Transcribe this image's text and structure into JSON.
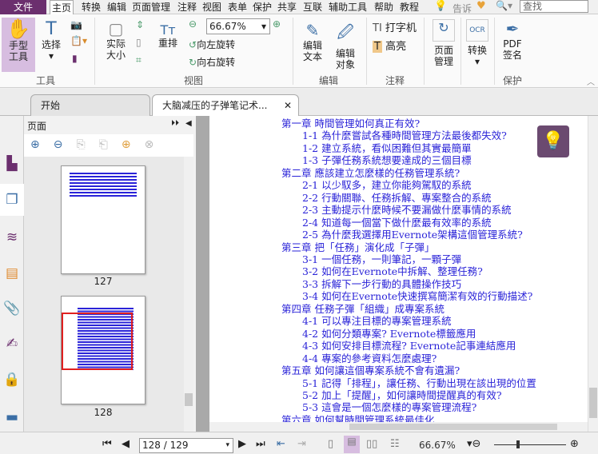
{
  "menu": {
    "file": "文件",
    "items": [
      "主页",
      "转换",
      "编辑",
      "页面管理",
      "注释",
      "视图",
      "表单",
      "保护",
      "共享",
      "互联",
      "辅助工具",
      "帮助",
      "教程"
    ],
    "tell": "告诉",
    "search_placeholder": "查找"
  },
  "ribbon": {
    "hand": "手型\n工具",
    "select": "选择",
    "group_tools": "工具",
    "actual_size": "实际\n大小",
    "reflow": "重排",
    "zoom": "66.67%",
    "rotate_left": "向左旋转",
    "rotate_right": "向右旋转",
    "group_view": "视图",
    "edit_text": "编辑\n文本",
    "edit_object": "编辑\n对象",
    "group_edit": "编辑",
    "typewriter": "打字机",
    "highlight": "高亮",
    "group_comment": "注释",
    "page_manage": "页面\n管理",
    "convert": "转换",
    "pdf_sign": "PDF\n签名",
    "group_protect": "保护"
  },
  "tabs": [
    {
      "label": "开始"
    },
    {
      "label": "大脑减压的子弹笔记术..."
    }
  ],
  "panel": {
    "title": "页面",
    "pages": [
      "127",
      "128"
    ]
  },
  "toc": [
    {
      "t": "第一章 時間管理如何真正有效?",
      "sub": false
    },
    {
      "t": "1-1 為什麼嘗試各種時間管理方法最後都失效?",
      "sub": true
    },
    {
      "t": "1-2 建立系統，看似困難但其實最簡單",
      "sub": true
    },
    {
      "t": "1-3 子彈任務系統想要達成的三個目標",
      "sub": true
    },
    {
      "t": "第二章 應該建立怎麼樣的任務管理系統?",
      "sub": false
    },
    {
      "t": "2-1 以少馭多，建立你能夠駕馭的系統",
      "sub": true
    },
    {
      "t": "2-2 行動關聯、任務拆解、專案整合的系統",
      "sub": true
    },
    {
      "t": "2-3 主動提示什麼時候不要漏做什麼事情的系統",
      "sub": true
    },
    {
      "t": "2-4 知道每一個當下做什麼最有效率的系統",
      "sub": true
    },
    {
      "t": "2-5 為什麼我選擇用Evernote架構這個管理系統?",
      "sub": true
    },
    {
      "t": "第三章 把「任務」演化成「子彈」",
      "sub": false
    },
    {
      "t": "3-1 一個任務，一則筆記，一顆子彈",
      "sub": true
    },
    {
      "t": "3-2 如何在Evernote中拆解、整理任務?",
      "sub": true
    },
    {
      "t": "3-3 拆解下一步行動的具體操作技巧",
      "sub": true
    },
    {
      "t": "3-4 如何在Evernote快速撰寫簡潔有效的行動描述?",
      "sub": true
    },
    {
      "t": "第四章 任務子彈「組織」成專案系統",
      "sub": false
    },
    {
      "t": "4-1 可以專注目標的專案管理系統",
      "sub": true
    },
    {
      "t": "4-2 如何分類專案? Evernote標籤應用",
      "sub": true
    },
    {
      "t": "4-3 如何安排目標流程? Evernote記事連結應用",
      "sub": true
    },
    {
      "t": "4-4 專案的參考資料怎麼處理?",
      "sub": true
    },
    {
      "t": "第五章 如何讓這個專案系統不會有遺漏?",
      "sub": false
    },
    {
      "t": "5-1 記得「排程」，讓任務、行動出現在該出現的位置",
      "sub": true
    },
    {
      "t": "5-2 加上「提醒」，如何讓時間提醒真的有效?",
      "sub": true
    },
    {
      "t": "5-3 這會是一個怎麼樣的專案管理流程?",
      "sub": true
    },
    {
      "t": "第六章 如何幫時間管理系統最佳化",
      "sub": false
    }
  ],
  "status": {
    "page": "128 / 129",
    "zoom": "66.67%"
  },
  "colors": {
    "brand": "#6b2f6e",
    "link": "#2a23d8"
  }
}
